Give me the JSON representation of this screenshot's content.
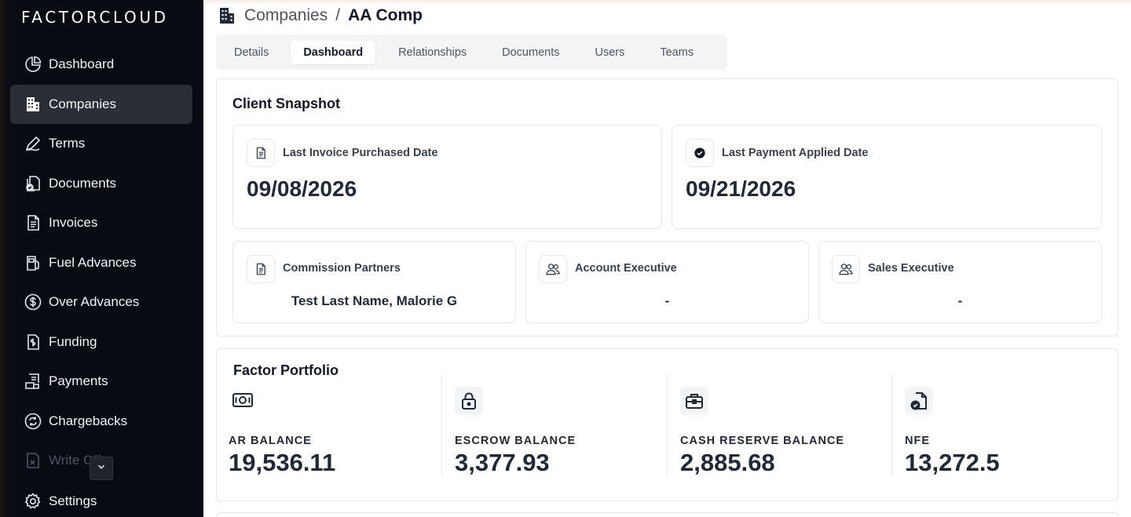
{
  "app": {
    "logo": "FACTORCLOUD"
  },
  "sidebar": {
    "items": [
      {
        "label": "Dashboard",
        "icon": "pie-chart-icon"
      },
      {
        "label": "Companies",
        "icon": "building-icon",
        "active": true
      },
      {
        "label": "Terms",
        "icon": "pen-icon"
      },
      {
        "label": "Documents",
        "icon": "documents-check-icon"
      },
      {
        "label": "Invoices",
        "icon": "invoice-icon"
      },
      {
        "label": "Fuel Advances",
        "icon": "fuel-icon"
      },
      {
        "label": "Over Advances",
        "icon": "dollar-circle-icon"
      },
      {
        "label": "Funding",
        "icon": "funding-icon"
      },
      {
        "label": "Payments",
        "icon": "payments-icon"
      },
      {
        "label": "Chargebacks",
        "icon": "chargeback-icon"
      },
      {
        "label": "Write Offs",
        "icon": "write-off-icon"
      },
      {
        "label": "Settings",
        "icon": "gear-icon"
      }
    ]
  },
  "breadcrumb": {
    "parent": "Companies",
    "separator": "/",
    "current": "AA Comp"
  },
  "tabs": [
    {
      "label": "Details"
    },
    {
      "label": "Dashboard",
      "active": true
    },
    {
      "label": "Relationships"
    },
    {
      "label": "Documents"
    },
    {
      "label": "Users"
    },
    {
      "label": "Teams"
    }
  ],
  "snapshot": {
    "title": "Client Snapshot",
    "last_invoice": {
      "label": "Last Invoice Purchased Date",
      "value": "09/08/2026"
    },
    "last_payment": {
      "label": "Last Payment Applied Date",
      "value": "09/21/2026"
    },
    "commission": {
      "label": "Commission Partners",
      "value": "Test Last Name, Malorie G"
    },
    "account_exec": {
      "label": "Account Executive",
      "value": "-"
    },
    "sales_exec": {
      "label": "Sales Executive",
      "value": "-"
    }
  },
  "portfolio": {
    "title": "Factor Portfolio",
    "metrics": [
      {
        "label": "AR BALANCE",
        "value": "19,536.11",
        "icon": "cash-icon"
      },
      {
        "label": "ESCROW BALANCE",
        "value": "3,377.93",
        "icon": "lock-icon"
      },
      {
        "label": "CASH RESERVE BALANCE",
        "value": "2,885.68",
        "icon": "briefcase-icon"
      },
      {
        "label": "NFE",
        "value": "13,272.5",
        "icon": "document-check-icon"
      }
    ]
  }
}
